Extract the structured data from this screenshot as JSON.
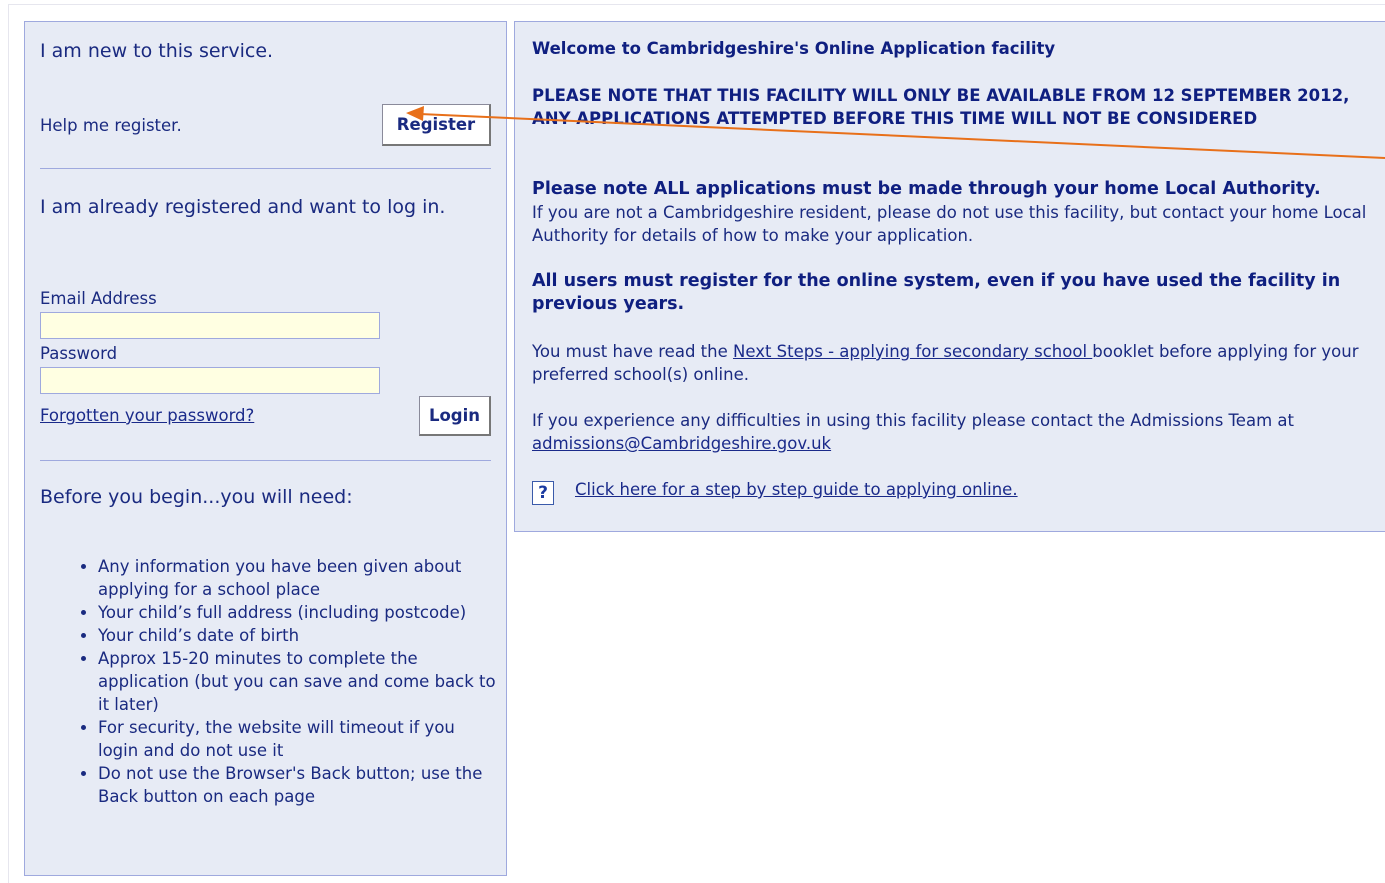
{
  "left": {
    "new_heading": "I am new to this service.",
    "help_register": "Help me register.",
    "register_button": "Register",
    "registered_heading": "I am already registered and want to log in.",
    "email_label": "Email Address",
    "email_value": "",
    "password_label": "Password",
    "password_value": "",
    "forgot_link": "Forgotten your password?",
    "login_button": "Login",
    "before_heading": "Before you begin...you will need:",
    "needs": [
      "Any information you have been given about applying for a school place",
      "Your child’s full address (including postcode)",
      "Your child’s date of birth",
      "Approx 15-20 minutes to complete the application (but you can save and come back to it later)",
      "For security, the website will timeout if you login and do not use it",
      "Do not use the Browser's Back button; use the Back button on each page"
    ]
  },
  "right": {
    "welcome": "Welcome to Cambridgeshire's Online Application facility",
    "notice": "PLEASE NOTE THAT THIS FACILITY WILL ONLY BE AVAILABLE FROM 12 SEPTEMBER 2012, ANY APPLICATIONS ATTEMPTED BEFORE THIS TIME WILL NOT BE CONSIDERED",
    "home_la_bold": "Please note ALL applications must be made through your home Local Authority.",
    "home_la_text": "If you are not a Cambridgeshire resident, please do not use this facility, but contact your home Local Authority for details of how to make your application.",
    "all_users": "All users must register for the online system, even if you have used the facility in previous years.",
    "next_steps_prefix": "You must have read the ",
    "next_steps_link": "Next Steps - applying for secondary school ",
    "next_steps_suffix": "booklet before applying for your preferred school(s) online.",
    "difficulties_text": "If you experience any difficulties in using this facility please contact the Admissions Team at ",
    "email_link": "admissions@Cambridgeshire.gov.uk",
    "help_icon_glyph": "?",
    "guide_link": "Click here for a step by step guide to applying online."
  },
  "colors": {
    "panel_bg": "#e7ebf5",
    "panel_border": "#9fa9de",
    "text": "#1a2a80",
    "field_bg": "#ffffe2",
    "annotation_arrow": "#e8701a"
  }
}
